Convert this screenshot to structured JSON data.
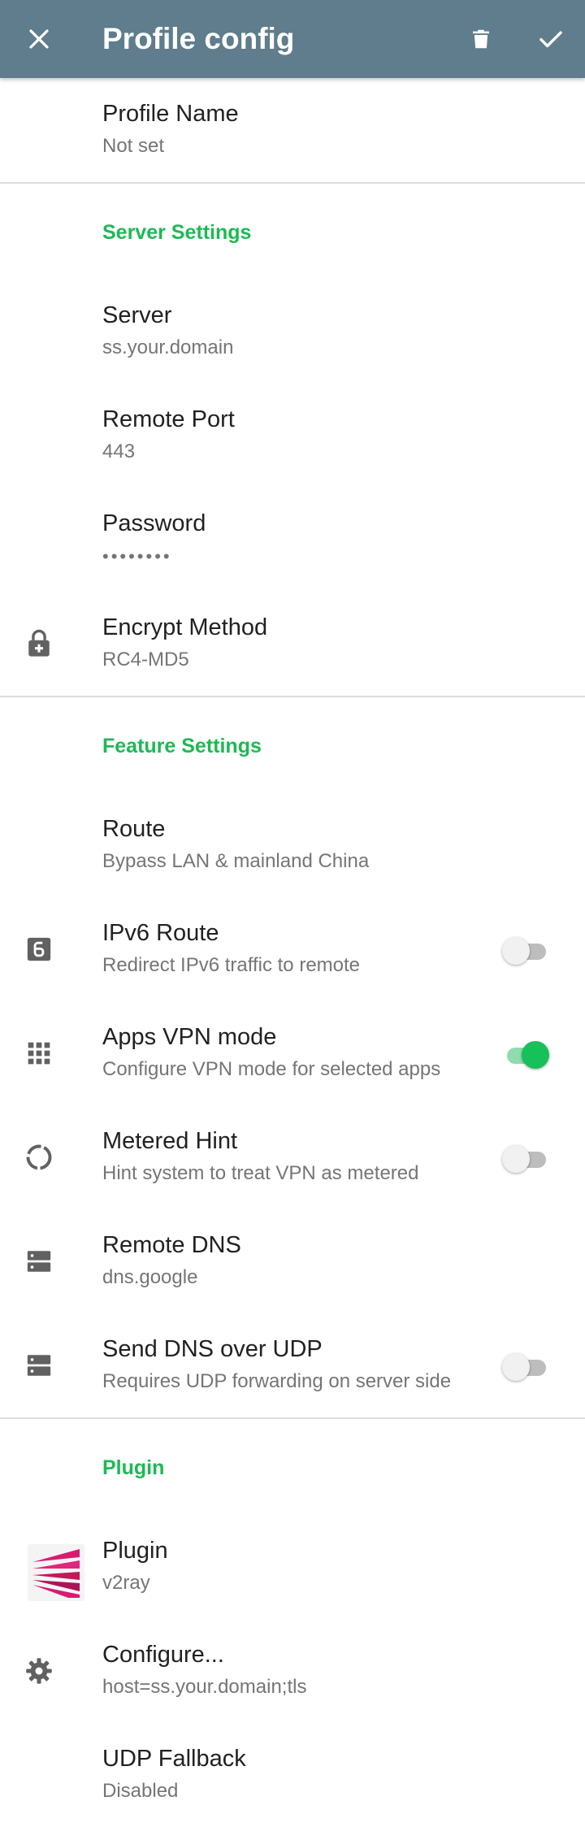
{
  "appbar": {
    "title": "Profile config",
    "close_icon": "close-icon",
    "delete_icon": "trash-icon",
    "save_icon": "check-icon",
    "color": "#5f7d8c"
  },
  "profile": {
    "name_title": "Profile Name",
    "name_value": "Not set"
  },
  "server_settings": {
    "header": "Server Settings",
    "server_title": "Server",
    "server_value": "ss.your.domain",
    "port_title": "Remote Port",
    "port_value": "443",
    "password_title": "Password",
    "password_value": "••••••••",
    "encrypt_title": "Encrypt Method",
    "encrypt_value": "RC4-MD5"
  },
  "feature_settings": {
    "header": "Feature Settings",
    "route_title": "Route",
    "route_value": "Bypass LAN & mainland China",
    "ipv6_title": "IPv6 Route",
    "ipv6_summary": "Redirect IPv6 traffic to remote",
    "ipv6_enabled": false,
    "apps_title": "Apps VPN mode",
    "apps_summary": "Configure VPN mode for selected apps",
    "apps_enabled": true,
    "metered_title": "Metered Hint",
    "metered_summary": "Hint system to treat VPN as metered",
    "metered_enabled": false,
    "dns_title": "Remote DNS",
    "dns_value": "dns.google",
    "udp_dns_title": "Send DNS over UDP",
    "udp_dns_summary": "Requires UDP forwarding on server side",
    "udp_dns_enabled": false
  },
  "plugin": {
    "header": "Plugin",
    "plugin_title": "Plugin",
    "plugin_value": "v2ray",
    "configure_title": "Configure...",
    "configure_value": "host=ss.your.domain;tls",
    "udp_fallback_title": "UDP Fallback",
    "udp_fallback_value": "Disabled"
  },
  "colors": {
    "accent": "#1db954",
    "switch_on": "#16c15a",
    "icon_gray": "#616161"
  }
}
